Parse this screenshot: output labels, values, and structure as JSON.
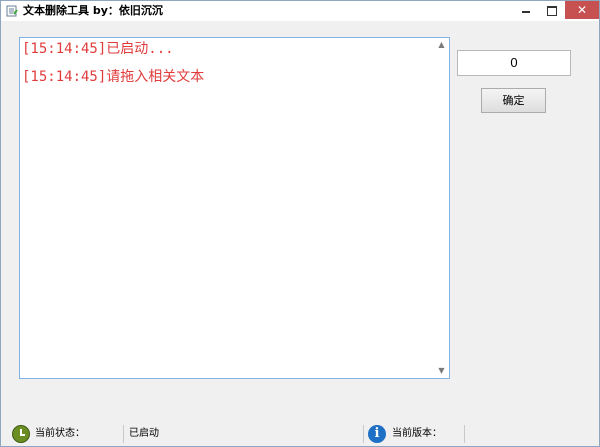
{
  "window": {
    "title": "文本删除工具 by：依旧沉沉",
    "close_glyph": "✕"
  },
  "log": {
    "lines": [
      "[15:14:45]已启动...",
      "[15:14:45]请拖入相关文本"
    ],
    "scroll_up": "▲",
    "scroll_down": "▼"
  },
  "controls": {
    "number_value": "0",
    "confirm_label": "确定"
  },
  "statusbar": {
    "status_label": "当前状态：",
    "status_value": "已启动",
    "version_label": "当前版本：",
    "info_glyph": "i"
  },
  "colors": {
    "log_text": "#e03c3c",
    "close_button": "#c75050",
    "accent_border": "#7eb4ea"
  },
  "icons": [
    "notepad-icon",
    "clock-icon",
    "info-icon"
  ]
}
